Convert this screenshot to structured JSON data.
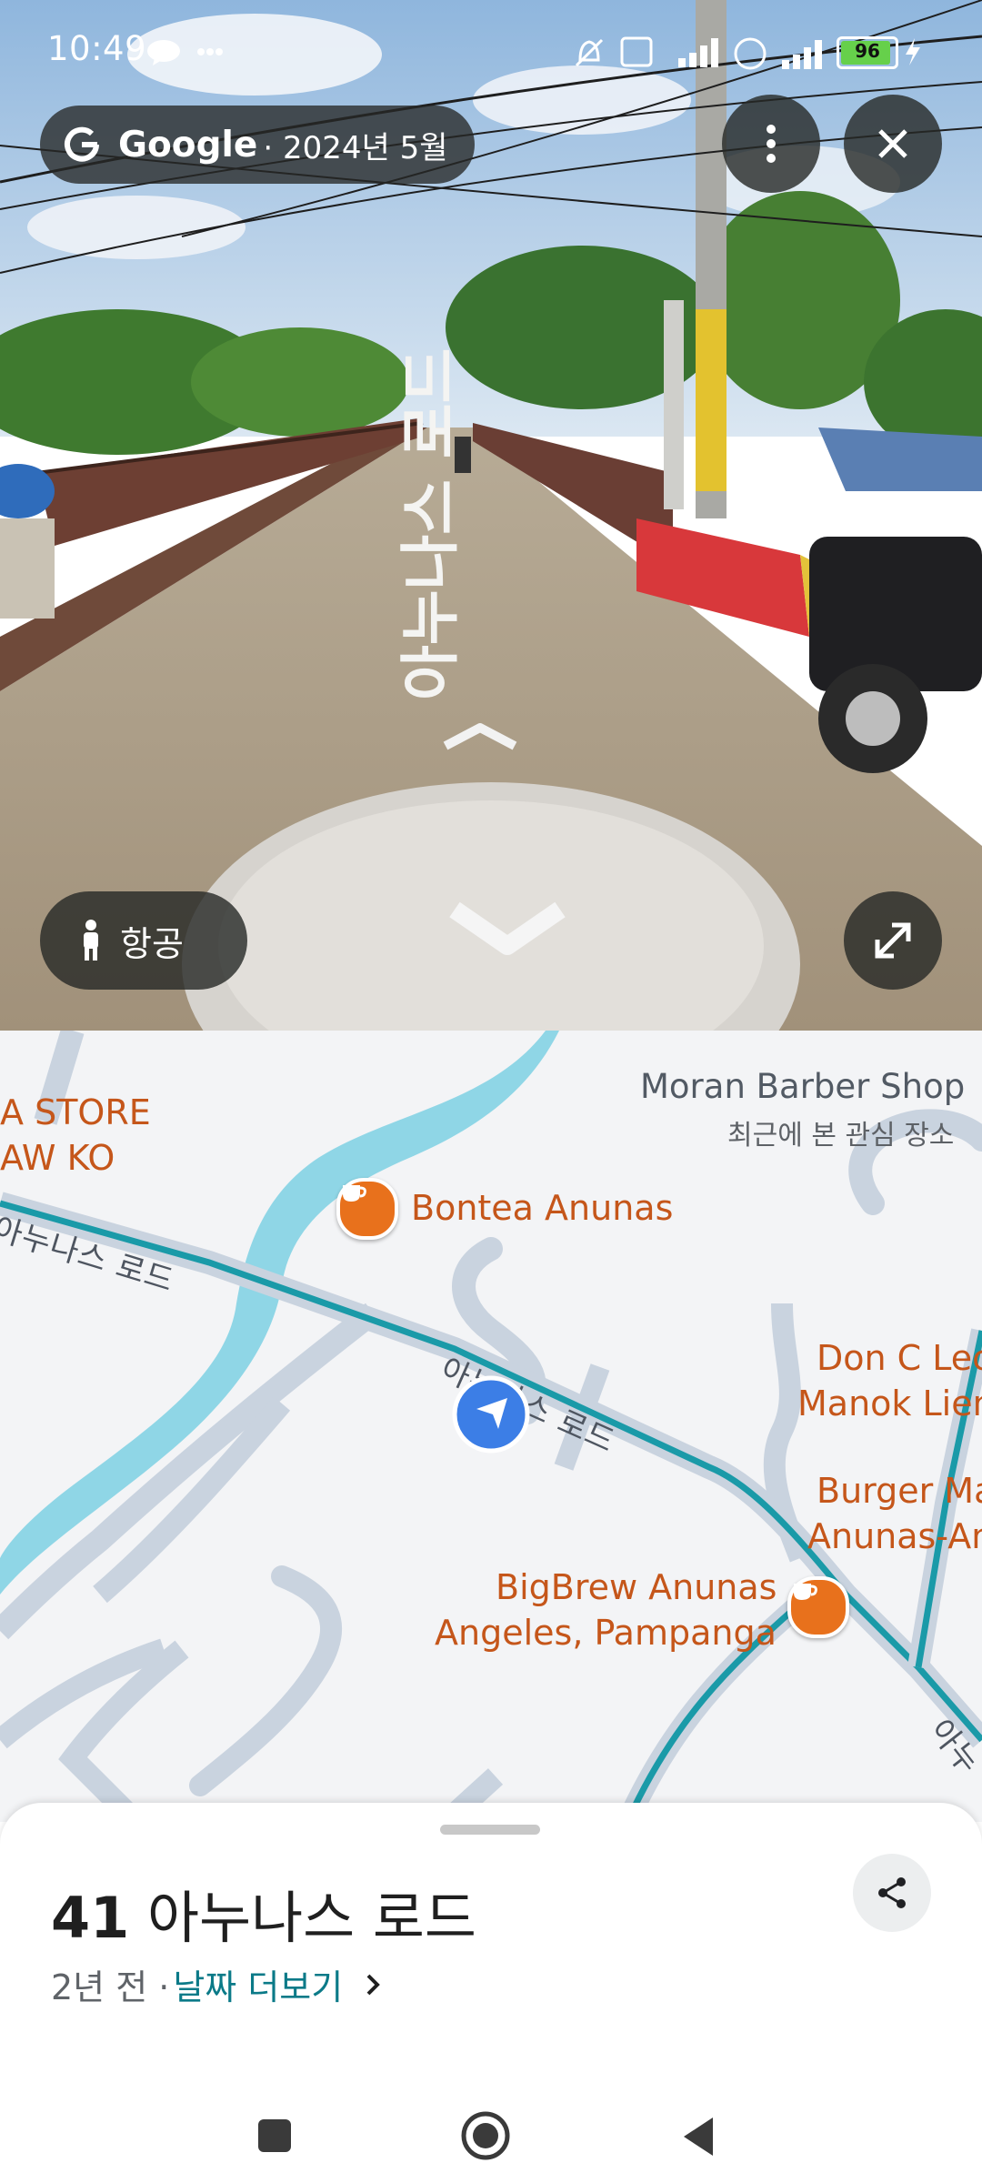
{
  "status_bar": {
    "time": "10:49",
    "battery": "96",
    "icons": [
      "talk-icon",
      "more-dots-icon",
      "alarm-off-icon",
      "volte-icon",
      "lte-signal-icon",
      "roaming-icon",
      "signal-icon",
      "battery-icon",
      "charging-icon"
    ]
  },
  "street_view": {
    "brand": "Google",
    "date": "· 2024년 5월",
    "road_paint_text": "아누나스 로드",
    "aerial_button_label": "항공",
    "buttons": {
      "menu": "vertical-dots-icon",
      "close": "close-icon",
      "expand": "expand-icon"
    }
  },
  "map": {
    "pois": [
      {
        "name": "Moran Barber Shop",
        "subtitle": "최근에 본 관심 장소"
      },
      {
        "name": "Bontea Anunas",
        "icon": "cafe-icon"
      },
      {
        "name_line1": "BigBrew Anunas",
        "name_line2": "Angeles, Pampanga",
        "icon": "cafe-icon"
      },
      {
        "name_line1": "Don C Lec",
        "name_line2": "Manok Lien"
      },
      {
        "name_line1": "Burger Ma",
        "name_line2": "Anunas-An"
      },
      {
        "name_line1": "A STORE",
        "name_line2": "AW KO"
      }
    ],
    "road_labels": [
      "아누나스 로드",
      "아누나스 로드",
      "아누"
    ],
    "accent": "#1a9aa8",
    "poi_color": "#c5561a",
    "location_color": "#3c7ee6"
  },
  "sheet": {
    "address_number": "41",
    "address_text": " 아누나스 로드",
    "age": "2년 전 ·",
    "more_dates": "날짜 더보기",
    "share_icon": "share-icon"
  },
  "nav": {
    "items": [
      "recent-apps-icon",
      "home-icon",
      "back-icon"
    ]
  }
}
